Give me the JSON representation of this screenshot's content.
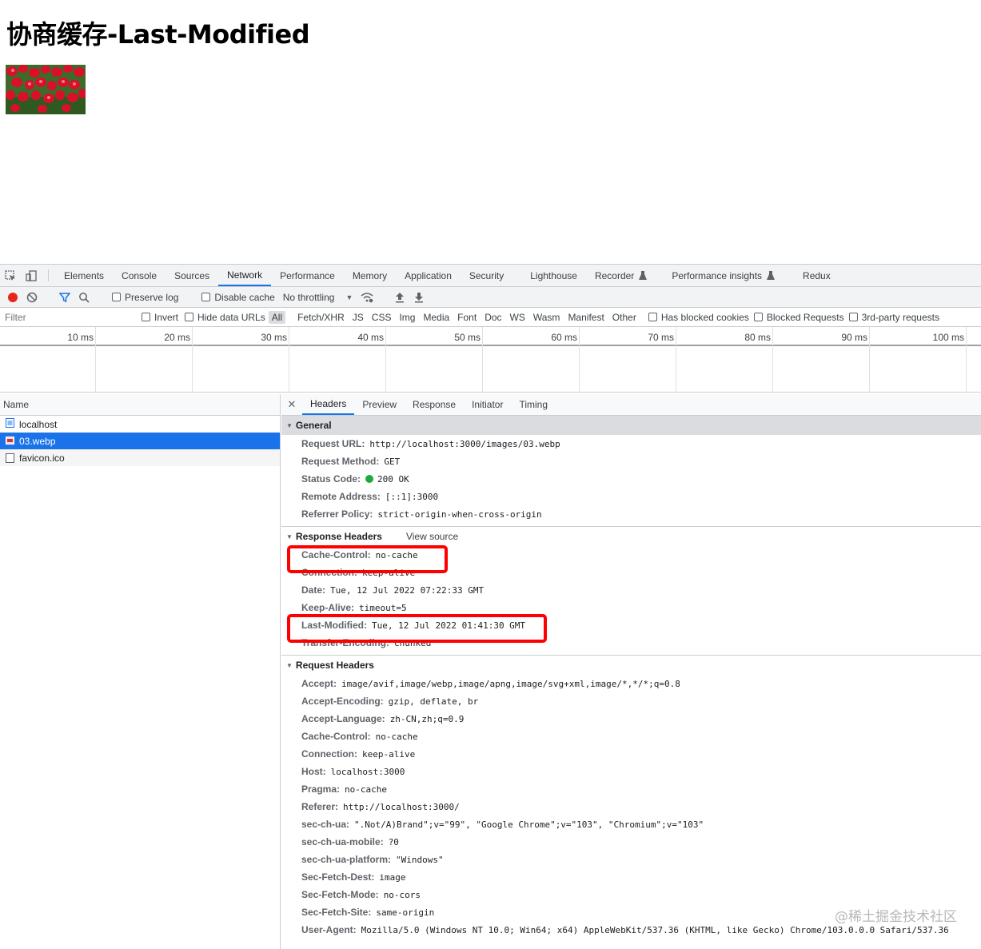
{
  "page": {
    "title": "协商缓存-Last-Modified"
  },
  "devtools": {
    "tabs": [
      "Elements",
      "Console",
      "Sources",
      "Network",
      "Performance",
      "Memory",
      "Application",
      "Security",
      "Lighthouse",
      "Recorder",
      "Performance insights",
      "Redux"
    ],
    "active_tab": "Network",
    "toolbar": {
      "preserve_log": "Preserve log",
      "disable_cache": "Disable cache",
      "throttling": "No throttling"
    },
    "filter": {
      "placeholder": "Filter",
      "invert": "Invert",
      "hide_data_urls": "Hide data URLs",
      "types": [
        "All",
        "Fetch/XHR",
        "JS",
        "CSS",
        "Img",
        "Media",
        "Font",
        "Doc",
        "WS",
        "Wasm",
        "Manifest",
        "Other"
      ],
      "has_blocked_cookies": "Has blocked cookies",
      "blocked_requests": "Blocked Requests",
      "third_party": "3rd-party requests"
    },
    "timeline": {
      "ticks": [
        "10 ms",
        "20 ms",
        "30 ms",
        "40 ms",
        "50 ms",
        "60 ms",
        "70 ms",
        "80 ms",
        "90 ms",
        "100 ms"
      ]
    },
    "requests": {
      "column": "Name",
      "items": [
        "localhost",
        "03.webp",
        "favicon.ico"
      ],
      "selected": "03.webp"
    },
    "detail_tabs": [
      "Headers",
      "Preview",
      "Response",
      "Initiator",
      "Timing"
    ],
    "general": {
      "title": "General",
      "rows": [
        {
          "k": "Request URL:",
          "v": "http://localhost:3000/images/03.webp"
        },
        {
          "k": "Request Method:",
          "v": "GET"
        },
        {
          "k": "Status Code:",
          "v": "200 OK"
        },
        {
          "k": "Remote Address:",
          "v": "[::1]:3000"
        },
        {
          "k": "Referrer Policy:",
          "v": "strict-origin-when-cross-origin"
        }
      ]
    },
    "response_headers": {
      "title": "Response Headers",
      "view_source": "View source",
      "rows": [
        {
          "k": "Cache-Control:",
          "v": "no-cache"
        },
        {
          "k": "Connection:",
          "v": "keep-alive"
        },
        {
          "k": "Date:",
          "v": "Tue, 12 Jul 2022 07:22:33 GMT"
        },
        {
          "k": "Keep-Alive:",
          "v": "timeout=5"
        },
        {
          "k": "Last-Modified:",
          "v": "Tue, 12 Jul 2022 01:41:30 GMT"
        },
        {
          "k": "Transfer-Encoding:",
          "v": "chunked"
        }
      ]
    },
    "request_headers": {
      "title": "Request Headers",
      "rows": [
        {
          "k": "Accept:",
          "v": "image/avif,image/webp,image/apng,image/svg+xml,image/*,*/*;q=0.8"
        },
        {
          "k": "Accept-Encoding:",
          "v": "gzip, deflate, br"
        },
        {
          "k": "Accept-Language:",
          "v": "zh-CN,zh;q=0.9"
        },
        {
          "k": "Cache-Control:",
          "v": "no-cache"
        },
        {
          "k": "Connection:",
          "v": "keep-alive"
        },
        {
          "k": "Host:",
          "v": "localhost:3000"
        },
        {
          "k": "Pragma:",
          "v": "no-cache"
        },
        {
          "k": "Referer:",
          "v": "http://localhost:3000/"
        },
        {
          "k": "sec-ch-ua:",
          "v": "\".Not/A)Brand\";v=\"99\", \"Google Chrome\";v=\"103\", \"Chromium\";v=\"103\""
        },
        {
          "k": "sec-ch-ua-mobile:",
          "v": "?0"
        },
        {
          "k": "sec-ch-ua-platform:",
          "v": "\"Windows\""
        },
        {
          "k": "Sec-Fetch-Dest:",
          "v": "image"
        },
        {
          "k": "Sec-Fetch-Mode:",
          "v": "no-cors"
        },
        {
          "k": "Sec-Fetch-Site:",
          "v": "same-origin"
        },
        {
          "k": "User-Agent:",
          "v": "Mozilla/5.0 (Windows NT 10.0; Win64; x64) AppleWebKit/537.36 (KHTML, like Gecko) Chrome/103.0.0.0 Safari/537.36"
        }
      ]
    }
  },
  "watermark": "@稀土掘金技术社区",
  "colors": {
    "accent": "#1a73e8",
    "highlight": "#ff0000",
    "status_ok": "#1fa83b"
  }
}
